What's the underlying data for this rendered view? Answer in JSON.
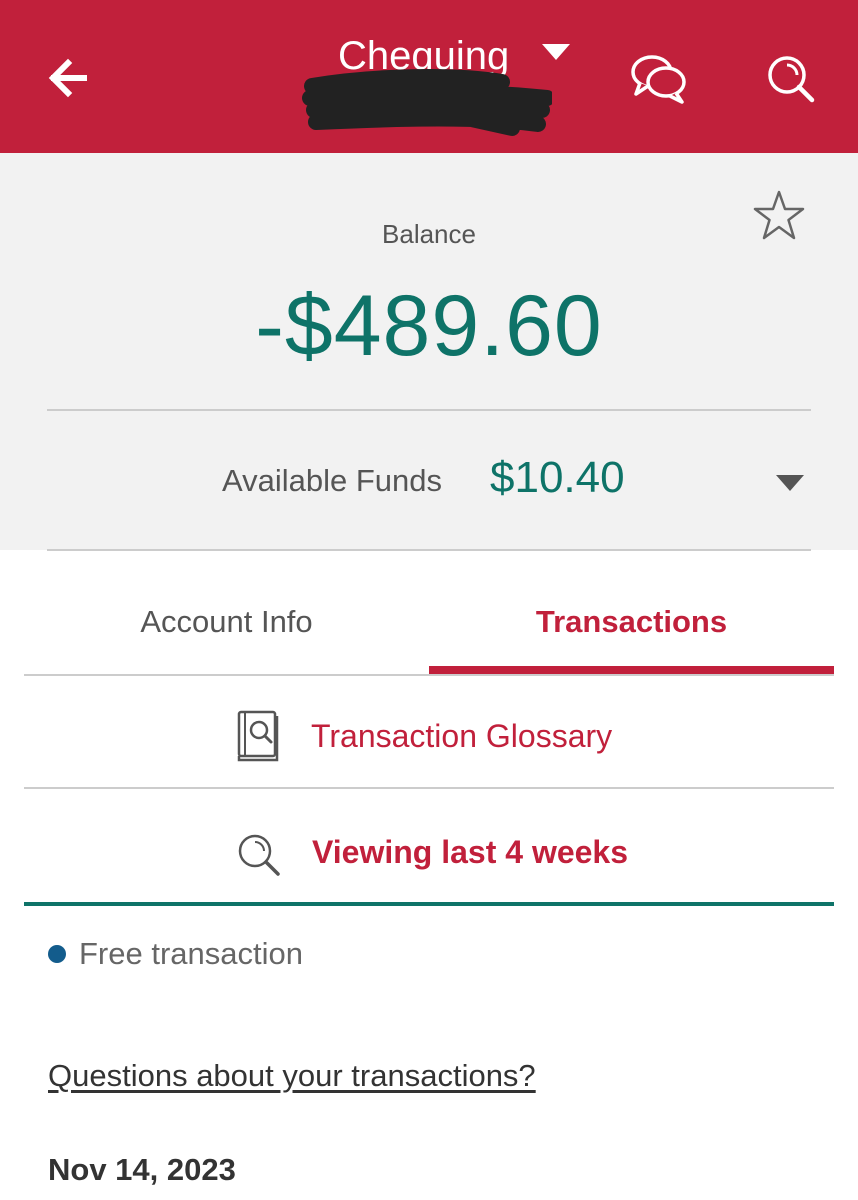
{
  "header": {
    "account_title": "Chequing",
    "background_color": "#c1203b",
    "back_icon": "back-arrow-icon",
    "title_caret_icon": "caret-down-icon",
    "chat_icon": "chat-bubbles-icon",
    "search_icon": "search-icon"
  },
  "balance": {
    "label": "Balance",
    "amount": "-$489.60",
    "favorite_icon": "star-outline-icon",
    "amount_color": "#0e7368"
  },
  "available_funds": {
    "label": "Available Funds",
    "amount": "$10.40",
    "caret_icon": "caret-down-icon"
  },
  "tabs": [
    {
      "label": "Account Info",
      "active": false
    },
    {
      "label": "Transactions",
      "active": true
    }
  ],
  "glossary": {
    "label": "Transaction Glossary",
    "icon": "book-search-icon"
  },
  "filter": {
    "label": "Viewing last 4 weeks",
    "icon": "search-icon"
  },
  "legend": {
    "label": "Free transaction",
    "dot_color": "#135c8c"
  },
  "help_link": "Questions about your transactions?",
  "transactions": {
    "date_header": "Nov 14, 2023"
  }
}
